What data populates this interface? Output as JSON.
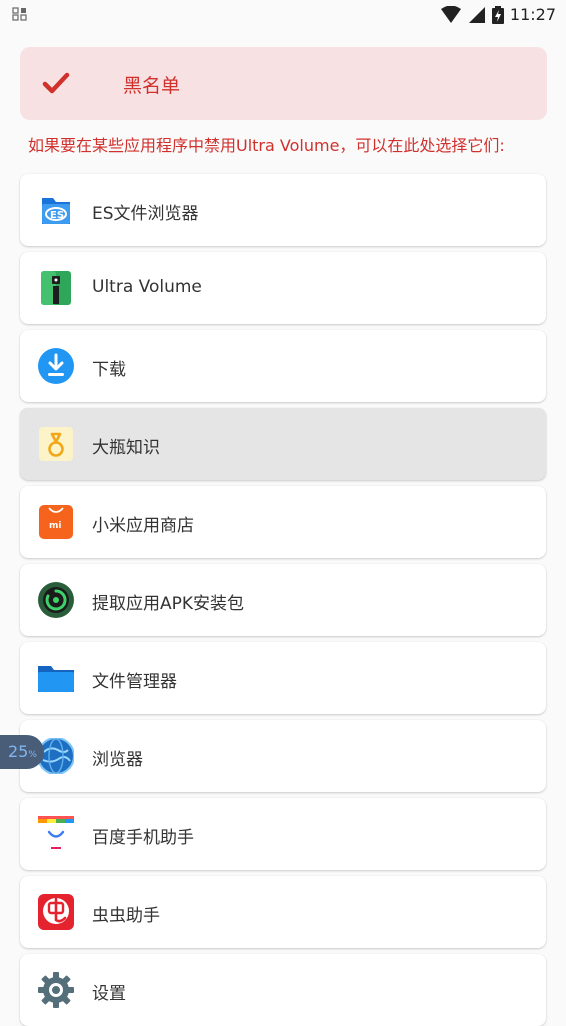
{
  "status_bar": {
    "time": "11:27"
  },
  "banner": {
    "title": "黑名单",
    "accent": "#d0312d",
    "background": "#f8e1e3"
  },
  "hint": "如果要在某些应用程序中禁用Ultra Volume，可以在此处选择它们:",
  "apps": [
    {
      "name": "ES文件浏览器",
      "icon": "es-file-explorer-icon",
      "selected": false
    },
    {
      "name": "Ultra Volume",
      "icon": "ultra-volume-icon",
      "selected": false
    },
    {
      "name": "下载",
      "icon": "download-icon",
      "selected": false
    },
    {
      "name": "大瓶知识",
      "icon": "dapin-knowledge-icon",
      "selected": true
    },
    {
      "name": "小米应用商店",
      "icon": "mi-store-icon",
      "selected": false
    },
    {
      "name": "提取应用APK安装包",
      "icon": "apk-extract-icon",
      "selected": false
    },
    {
      "name": "文件管理器",
      "icon": "folder-icon",
      "selected": false
    },
    {
      "name": "浏览器",
      "icon": "browser-globe-icon",
      "selected": false
    },
    {
      "name": "百度手机助手",
      "icon": "baidu-assistant-icon",
      "selected": false
    },
    {
      "name": "虫虫助手",
      "icon": "chongchong-icon",
      "selected": false
    },
    {
      "name": "设置",
      "icon": "gear-icon",
      "selected": false
    }
  ],
  "floating_badge": {
    "value": "25",
    "unit": "%"
  }
}
